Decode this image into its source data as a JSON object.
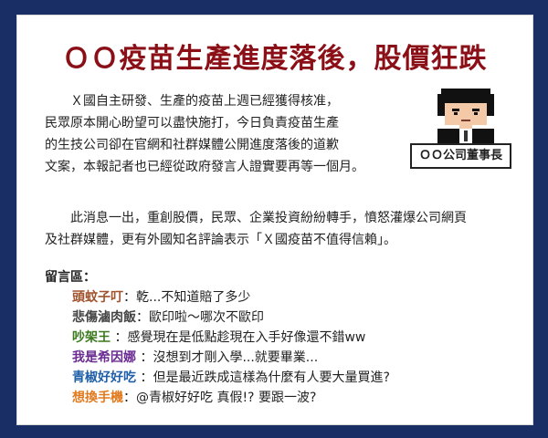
{
  "headline": "ＯＯ疫苗生產進度落後，股價狂跌",
  "article": {
    "para1_lines": [
      "Ｘ國自主研發、生產的疫苗上週已經獲得核准，",
      "民眾原本開心盼望可以盡快施打，今日負責疫苗生產",
      "的生技公司卻在官網和社群媒體公開進度落後的道歉",
      "文案，本報記者也已經從政府發言人證實要再等一個月。"
    ],
    "para2_lines": [
      "此消息一出，重創股價，民眾、企業投資紛紛轉手，憤怒灌爆公司網頁",
      "及社群媒體，更有外國知名評論表示「Ｘ國疫苗不值得信賴」。"
    ]
  },
  "figure": {
    "icon": "pixel-man-icon",
    "caption": "ＯＯ公司董事長"
  },
  "comments_title": "留言區：",
  "comments": [
    {
      "user": "頭蚊子叮",
      "sep": "：",
      "text": "乾...不知道賠了多少",
      "color": "#a0522d"
    },
    {
      "user": "悲傷滷肉飯",
      "sep": "：",
      "text": "歐印啦～哪次不歐印",
      "color": "#444444"
    },
    {
      "user": "吵架王",
      "sep": " ：",
      "text": "感覺現在是低點趁現在入手好像還不錯ww",
      "color": "#3b7a1e"
    },
    {
      "user": "我是希因娜",
      "sep": " ：",
      "text": "沒想到才剛入學...就要畢業...",
      "color": "#6a2c91"
    },
    {
      "user": "青椒好好吃",
      "sep": " ：",
      "text": "但是最近跌成這樣為什麼有人要大量買進?",
      "color": "#1f5fa8"
    },
    {
      "user": "想換手機",
      "sep": "：",
      "text": "@青椒好好吃 真假!? 要跟一波?",
      "color": "#e07a1f"
    }
  ]
}
